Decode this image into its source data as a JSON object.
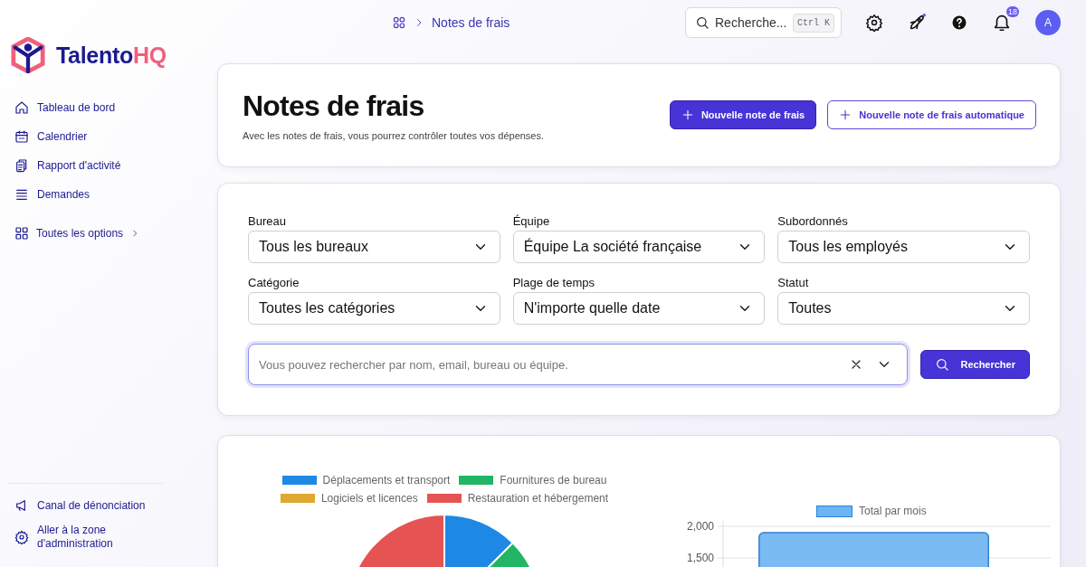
{
  "brand": {
    "name": "Talento",
    "suffix": "HQ"
  },
  "sidebar": {
    "items": [
      {
        "label": "Tableau de bord"
      },
      {
        "label": "Calendrier"
      },
      {
        "label": "Rapport d'activité"
      },
      {
        "label": "Demandes"
      }
    ],
    "all_options": "Toutes les options",
    "footer_items": [
      {
        "label": "Canal de dénonciation"
      },
      {
        "label": "Aller à la zone d'administration"
      }
    ]
  },
  "topbar": {
    "breadcrumb": "Notes de frais",
    "search": {
      "placeholder": "Recherche...",
      "shortcut": "Ctrl K"
    },
    "notifications": "18",
    "avatar": "A"
  },
  "header": {
    "title": "Notes de frais",
    "subtitle": "Avec les notes de frais, vous pourrez contrôler toutes vos dépenses.",
    "buttons": [
      {
        "label": "Nouvelle note de frais",
        "kind": "primary"
      },
      {
        "label": "Nouvelle note de frais automatique",
        "kind": "outline"
      }
    ]
  },
  "filters": [
    {
      "label": "Bureau",
      "value": "Tous les bureaux"
    },
    {
      "label": "Équipe",
      "value": "Équipe La société française"
    },
    {
      "label": "Subordonnés",
      "value": "Tous les employés"
    },
    {
      "label": "Catégorie",
      "value": "Toutes les catégories"
    },
    {
      "label": "Plage de temps",
      "value": "N'importe quelle date"
    },
    {
      "label": "Statut",
      "value": "Toutes"
    }
  ],
  "search": {
    "placeholder": "Vous pouvez rechercher par nom, email, bureau ou équipe.",
    "button": "Rechercher"
  },
  "pie_legend": [
    {
      "label": "Déplacements et transport",
      "color": "#1e88e5"
    },
    {
      "label": "Fournitures de bureau",
      "color": "#22b566"
    },
    {
      "label": "Logiciels et licences",
      "color": "#e0a82e"
    },
    {
      "label": "Restauration et hébergement",
      "color": "#e55353"
    }
  ],
  "bar_chart": {
    "chart_data": {
      "type": "bar",
      "ylim": [
        0,
        2000
      ],
      "yticks": [
        {
          "value": 1500,
          "label": "1,500"
        },
        {
          "value": 2000,
          "label": "2,000"
        }
      ],
      "series": [
        {
          "name": "Total par mois",
          "color": "#6cb4f2",
          "values": [
            1900
          ]
        }
      ]
    }
  }
}
